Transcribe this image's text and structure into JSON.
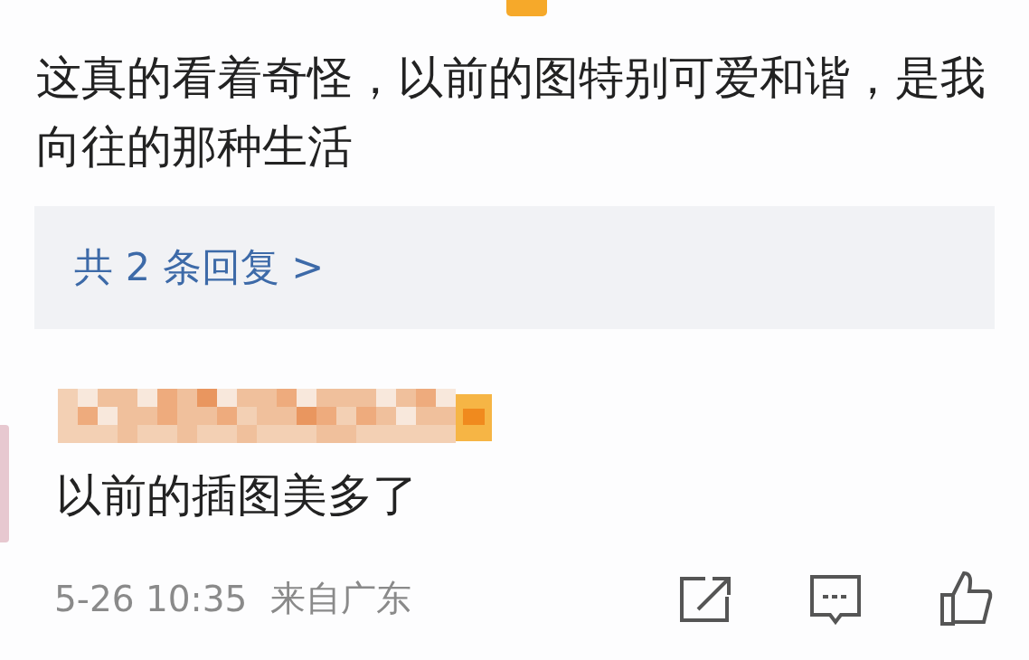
{
  "comment": {
    "text": "这真的看着奇怪，以前的图特别可爱和谐，是我向往的那种生活"
  },
  "replies_link": {
    "text": "共 2 条回复 >"
  },
  "reply": {
    "text": "以前的插图美多了"
  },
  "footer": {
    "time": "5-26 10:35",
    "source": "来自广东"
  }
}
